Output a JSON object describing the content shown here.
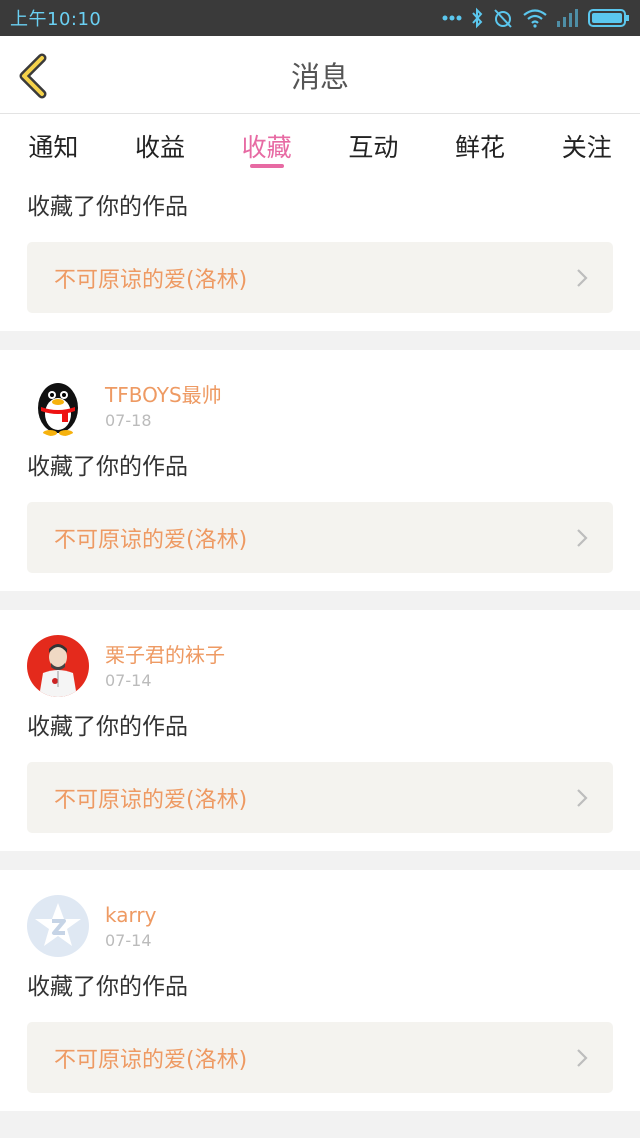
{
  "statusbar": {
    "time": "上午10:10"
  },
  "header": {
    "title": "消息"
  },
  "tabs": [
    {
      "label": "通知",
      "active": false
    },
    {
      "label": "收益",
      "active": false
    },
    {
      "label": "收藏",
      "active": true
    },
    {
      "label": "互动",
      "active": false
    },
    {
      "label": "鲜花",
      "active": false
    },
    {
      "label": "关注",
      "active": false
    }
  ],
  "cards": [
    {
      "action": "收藏了你的作品",
      "work_title": "不可原谅的爱(洛林)"
    },
    {
      "username": "TFBOYS最帅",
      "date": "07-18",
      "avatar": "qq-penguin",
      "action": "收藏了你的作品",
      "work_title": "不可原谅的爱(洛林)"
    },
    {
      "username": "栗子君的袜子",
      "date": "07-14",
      "avatar": "red-portrait",
      "action": "收藏了你的作品",
      "work_title": "不可原谅的爱(洛林)"
    },
    {
      "username": "karry",
      "date": "07-14",
      "avatar": "default-star",
      "action": "收藏了你的作品",
      "work_title": "不可原谅的爱(洛林)"
    }
  ],
  "colors": {
    "accent": "#e76aa3",
    "username": "#ee9a63",
    "statusbar_bg": "#3a3a3a"
  }
}
